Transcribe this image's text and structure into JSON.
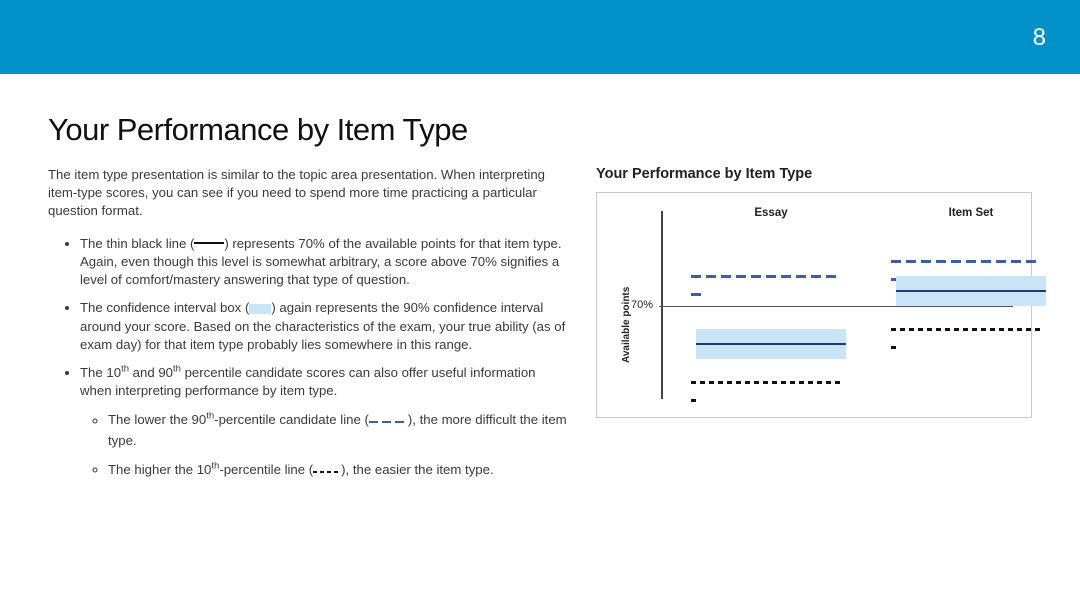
{
  "page_number": "8",
  "title": "Your Performance by Item Type",
  "intro": "The item type presentation is similar to the topic area presentation. When interpreting item-type scores, you can see if you need to spend more time practicing a particular question format.",
  "bullets": {
    "b1a": "The thin black line (",
    "b1b": ") represents 70% of the available points for that item type. Again, even though this level is somewhat arbitrary, a score above 70% signifies a level of comfort/mastery answering that type of question.",
    "b2a": "The confidence interval box (",
    "b2b": ") again represents the 90% confidence interval around your score. Based on the characteristics of the exam, your true ability (as of exam day) for that item type probably lies somewhere in this range.",
    "b3a": "The 10",
    "b3b": " and 90",
    "b3c": " percentile candidate scores can also offer useful information when interpreting performance by item type.",
    "s1a": "The lower the 90",
    "s1b": "-percentile candidate line (",
    "s1c": "), the more difficult the item type.",
    "s2a": "The higher the 10",
    "s2b": "-percentile line (",
    "s2c": "), the easier the item type.",
    "th": "th"
  },
  "chart": {
    "title": "Your Performance by Item Type",
    "ylabel": "Available points",
    "baseline_label": "70%",
    "categories": {
      "essay": "Essay",
      "itemset": "Item Set"
    }
  },
  "chart_data": {
    "type": "other",
    "title": "Your Performance by Item Type",
    "ylabel": "Available points",
    "baseline_pct": 70,
    "ylim": [
      45,
      95
    ],
    "series_meta": {
      "p90": {
        "name": "90th percentile",
        "style": "dashed-blue"
      },
      "p10": {
        "name": "10th percentile",
        "style": "dotted-black"
      },
      "score": {
        "name": "Your score",
        "style": "solid-dark-blue"
      },
      "ci": {
        "name": "90% confidence interval",
        "style": "light-blue-box"
      }
    },
    "items": [
      {
        "category": "Essay",
        "score": 60,
        "ci_low": 56,
        "ci_high": 64,
        "p90": 78,
        "p10": 50
      },
      {
        "category": "Item Set",
        "score": 74,
        "ci_low": 70,
        "ci_high": 78,
        "p90": 82,
        "p10": 64
      }
    ]
  }
}
